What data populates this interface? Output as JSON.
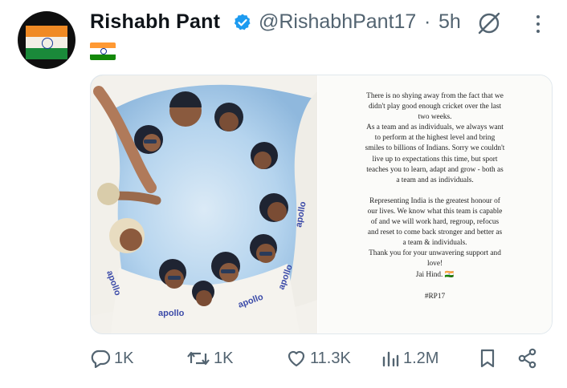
{
  "author": {
    "name": "Rishabh Pant",
    "handle": "@RishabhPant17",
    "separator": "·",
    "time": "5h",
    "verified": true,
    "icons": {
      "verified": "verified-badge-icon",
      "grok": "grok-icon",
      "more": "more-options-icon"
    }
  },
  "tweet": {
    "flag_icon": "india-flag-icon"
  },
  "statement": {
    "lines": [
      "There is no shying away from the fact that we",
      "didn't play good enough cricket over the last",
      "two weeks.",
      "As a team and as individuals, we always want",
      "to perform at the highest level and bring",
      "smiles to billions of Indians. Sorry we couldn't",
      "live up to expectations this time, but sport",
      "teaches you to learn, adapt and grow - both as",
      "a team and as individuals."
    ],
    "lines2": [
      "Representing India is the greatest honour of",
      "our lives. We know what this team is capable",
      "of and we will work hard, regroup, refocus",
      "and reset to come back stronger and better as",
      "a team & individuals.",
      "Thank you for your unwavering support and",
      "love!",
      "Jai Hind. 🇮🇳"
    ],
    "hashtag": "#RP17"
  },
  "actions": {
    "replies": "1K",
    "reposts": "1K",
    "likes": "11.3K",
    "views": "1.2M",
    "icons": {
      "reply": "reply-icon",
      "repost": "repost-icon",
      "like": "heart-icon",
      "views": "views-icon",
      "bookmark": "bookmark-icon",
      "share": "share-icon"
    }
  },
  "colors": {
    "verified_blue": "#1d9bf0",
    "secondary_text": "#536471",
    "jersey": "#f5f3ee",
    "sky": "#a9cdea"
  }
}
